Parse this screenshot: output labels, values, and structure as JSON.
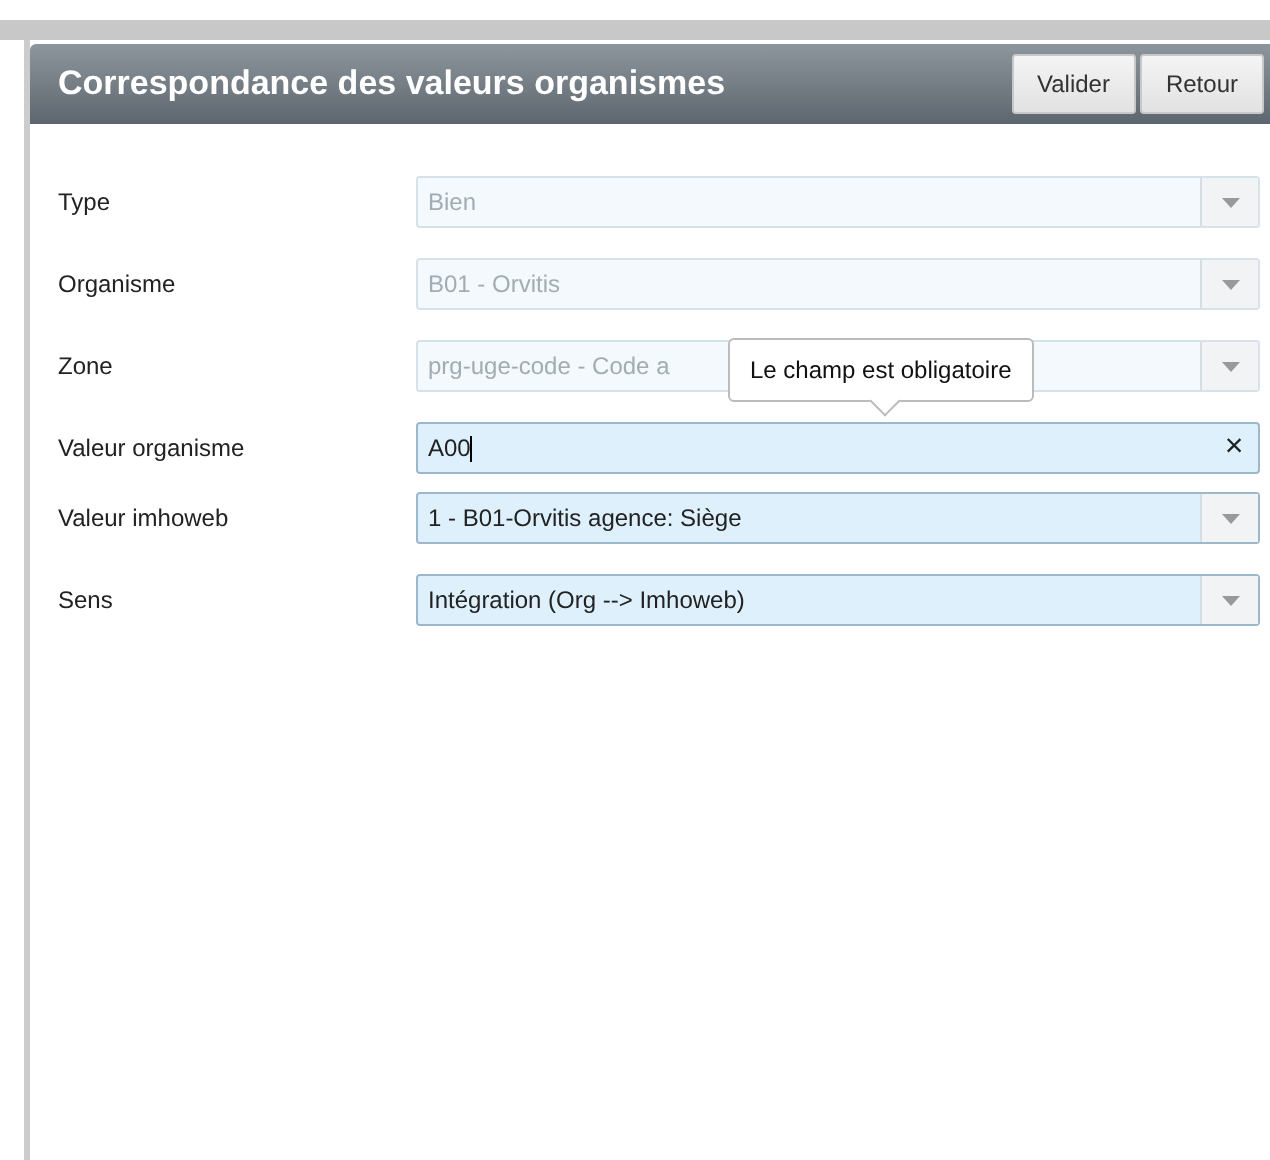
{
  "dialog": {
    "title": "Correspondance des valeurs organismes",
    "buttons": [
      "Valider",
      "Retour"
    ]
  },
  "fields": [
    {
      "label": "Type",
      "kind": "select",
      "value": "Bien",
      "disabled": true
    },
    {
      "label": "Organisme",
      "kind": "select",
      "value": "B01 - Orvitis",
      "disabled": true
    },
    {
      "label": "Zone",
      "kind": "select",
      "value": "prg-uge-code - Code a",
      "disabled": true
    },
    {
      "label": "Valeur organisme",
      "kind": "text",
      "value": "A00",
      "disabled": false,
      "tooltip": "Le champ est obligatoire",
      "clear": "×"
    },
    {
      "label": "Valeur imhoweb",
      "kind": "select",
      "value": "1 - B01-Orvitis agence: Siège",
      "disabled": false
    },
    {
      "label": "Sens",
      "kind": "select",
      "value": "Intégration (Org --> Imhoweb)",
      "disabled": false
    }
  ]
}
